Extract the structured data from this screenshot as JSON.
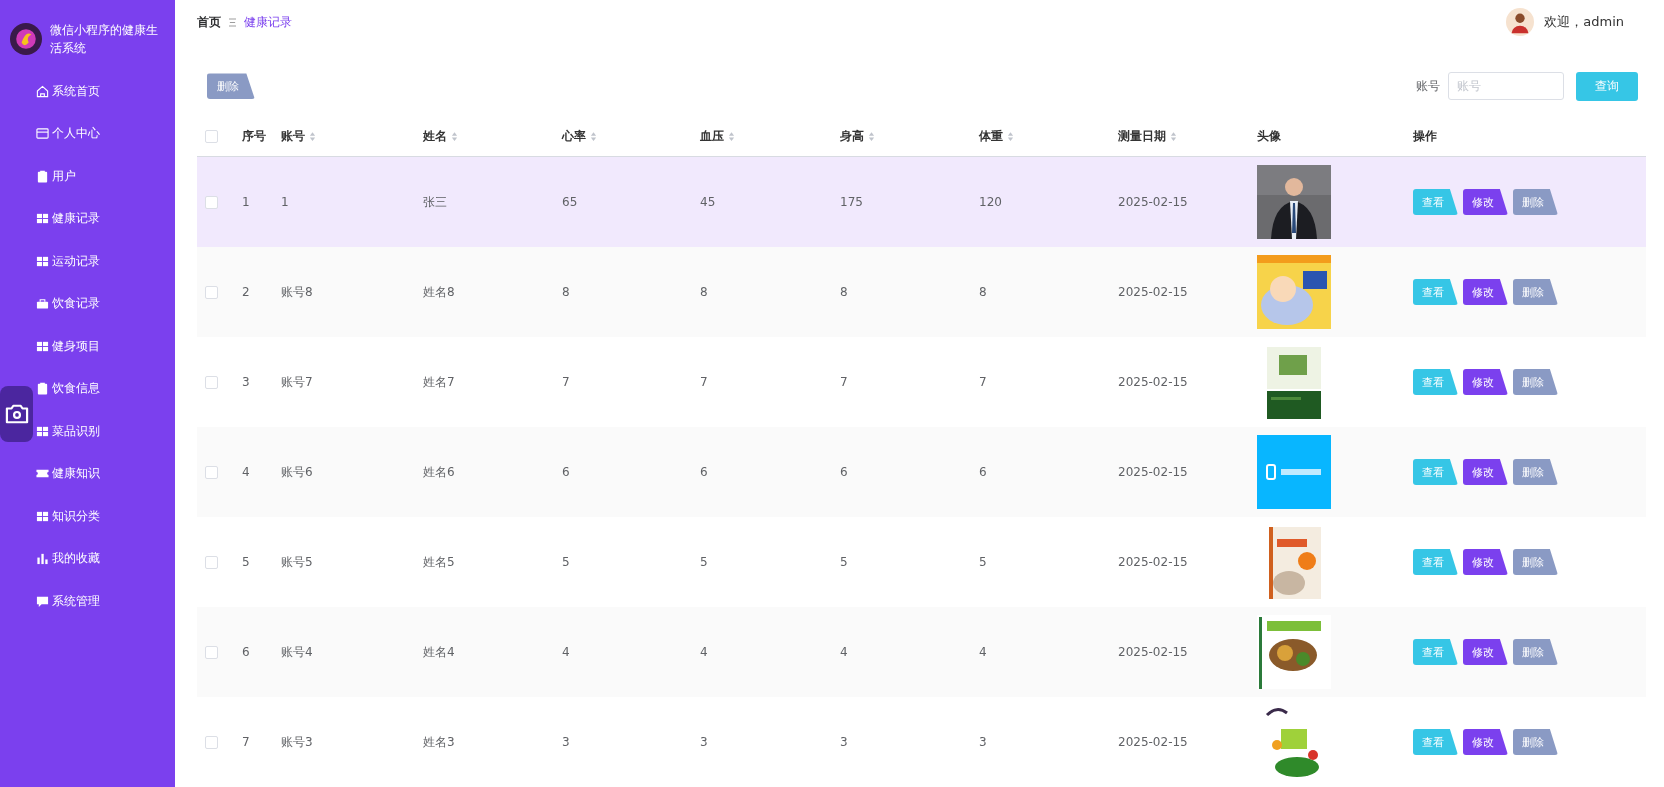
{
  "sidebar": {
    "title": "微信小程序的健康生活系统",
    "items": [
      {
        "label": "系统首页"
      },
      {
        "label": "个人中心"
      },
      {
        "label": "用户"
      },
      {
        "label": "健康记录"
      },
      {
        "label": "运动记录"
      },
      {
        "label": "饮食记录"
      },
      {
        "label": "健身项目"
      },
      {
        "label": "饮食信息"
      },
      {
        "label": "菜品识别"
      },
      {
        "label": "健康知识"
      },
      {
        "label": "知识分类"
      },
      {
        "label": "我的收藏"
      },
      {
        "label": "系统管理"
      }
    ]
  },
  "breadcrumb": [
    {
      "label": "首页",
      "selected": false
    },
    {
      "label": "健康记录",
      "selected": true
    }
  ],
  "user": {
    "greeting": "欢迎，admin"
  },
  "toolbar": {
    "delete_button": "删除",
    "search_label": "账号",
    "search": {
      "placeholder": "账号"
    },
    "query_button": "查询"
  },
  "table": {
    "select_all": {
      "checked": false
    },
    "columns": [
      {
        "label": "序号",
        "sortable": false
      },
      {
        "label": "账号",
        "sortable": true
      },
      {
        "label": "姓名",
        "sortable": true
      },
      {
        "label": "心率",
        "sortable": true
      },
      {
        "label": "血压",
        "sortable": true
      },
      {
        "label": "身高",
        "sortable": true
      },
      {
        "label": "体重",
        "sortable": true
      },
      {
        "label": "测量日期",
        "sortable": true
      },
      {
        "label": "头像",
        "sortable": false
      },
      {
        "label": "操作",
        "sortable": false
      }
    ],
    "rows": [
      {
        "checked": false,
        "hovered": true,
        "cells": [
          "1",
          "1",
          "张三",
          "65",
          "45",
          "175",
          "120",
          "2025-02-15"
        ],
        "actions": [
          {
            "label": "查看",
            "kind": "view"
          },
          {
            "label": "修改",
            "kind": "edit"
          },
          {
            "label": "删除",
            "kind": "delete"
          }
        ]
      },
      {
        "checked": false,
        "hovered": false,
        "cells": [
          "2",
          "账号8",
          "姓名8",
          "8",
          "8",
          "8",
          "8",
          "2025-02-15"
        ],
        "actions": [
          {
            "label": "查看",
            "kind": "view"
          },
          {
            "label": "修改",
            "kind": "edit"
          },
          {
            "label": "删除",
            "kind": "delete"
          }
        ]
      },
      {
        "checked": false,
        "hovered": false,
        "cells": [
          "3",
          "账号7",
          "姓名7",
          "7",
          "7",
          "7",
          "7",
          "2025-02-15"
        ],
        "actions": [
          {
            "label": "查看",
            "kind": "view"
          },
          {
            "label": "修改",
            "kind": "edit"
          },
          {
            "label": "删除",
            "kind": "delete"
          }
        ]
      },
      {
        "checked": false,
        "hovered": false,
        "cells": [
          "4",
          "账号6",
          "姓名6",
          "6",
          "6",
          "6",
          "6",
          "2025-02-15"
        ],
        "actions": [
          {
            "label": "查看",
            "kind": "view"
          },
          {
            "label": "修改",
            "kind": "edit"
          },
          {
            "label": "删除",
            "kind": "delete"
          }
        ]
      },
      {
        "checked": false,
        "hovered": false,
        "cells": [
          "5",
          "账号5",
          "姓名5",
          "5",
          "5",
          "5",
          "5",
          "2025-02-15"
        ],
        "actions": [
          {
            "label": "查看",
            "kind": "view"
          },
          {
            "label": "修改",
            "kind": "edit"
          },
          {
            "label": "删除",
            "kind": "delete"
          }
        ]
      },
      {
        "checked": false,
        "hovered": false,
        "cells": [
          "6",
          "账号4",
          "姓名4",
          "4",
          "4",
          "4",
          "4",
          "2025-02-15"
        ],
        "actions": [
          {
            "label": "查看",
            "kind": "view"
          },
          {
            "label": "修改",
            "kind": "edit"
          },
          {
            "label": "删除",
            "kind": "delete"
          }
        ]
      },
      {
        "checked": false,
        "hovered": false,
        "cells": [
          "7",
          "账号3",
          "姓名3",
          "3",
          "3",
          "3",
          "3",
          "2025-02-15"
        ],
        "actions": [
          {
            "label": "查看",
            "kind": "view"
          },
          {
            "label": "修改",
            "kind": "edit"
          },
          {
            "label": "删除",
            "kind": "delete"
          }
        ]
      }
    ]
  }
}
